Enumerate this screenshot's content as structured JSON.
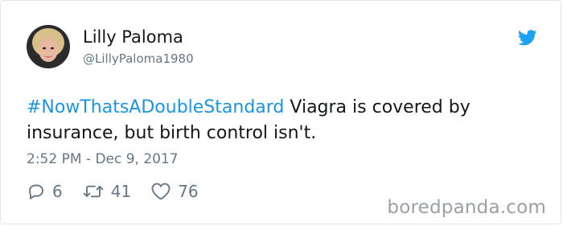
{
  "tweet": {
    "author_name": "Lilly Paloma",
    "author_handle": "@LillyPaloma1980",
    "hashtag": "#NowThatsADoubleStandard",
    "body": " Viagra is covered by insurance, but birth control isn't.",
    "timestamp": "2:52 PM - Dec 9, 2017",
    "replies": "6",
    "retweets": "41",
    "likes": "76"
  },
  "icons": {
    "avatar": "avatar",
    "brand": "twitter-bird-icon",
    "reply": "reply-icon",
    "retweet": "retweet-icon",
    "like": "heart-icon"
  },
  "colors": {
    "accent": "#1b95e0",
    "muted": "#657786",
    "text": "#14171a"
  },
  "watermark": "boredpanda.com"
}
